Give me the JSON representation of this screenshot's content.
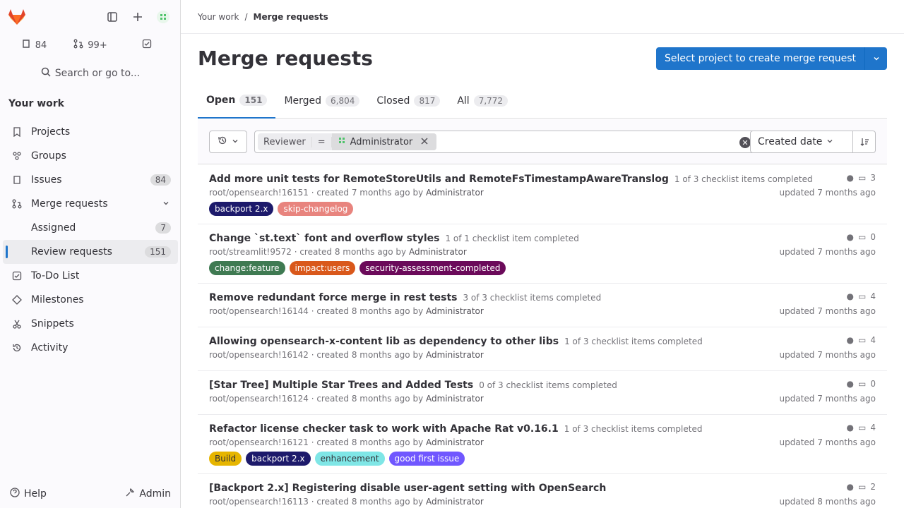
{
  "sidebar": {
    "counters": [
      {
        "icon": "issues-icon",
        "value": "84"
      },
      {
        "icon": "merge-request-icon",
        "value": "99+"
      },
      {
        "icon": "todo-icon",
        "value": ""
      }
    ],
    "search_label": "Search or go to...",
    "section_title": "Your work",
    "nav": {
      "projects": "Projects",
      "groups": "Groups",
      "issues": "Issues",
      "issues_count": "84",
      "merge_requests": "Merge requests",
      "assigned": "Assigned",
      "assigned_count": "7",
      "review_requests": "Review requests",
      "review_count": "151",
      "todo": "To-Do List",
      "milestones": "Milestones",
      "snippets": "Snippets",
      "activity": "Activity"
    },
    "help": "Help",
    "admin": "Admin"
  },
  "breadcrumb": {
    "parent": "Your work",
    "separator": "/",
    "current": "Merge requests"
  },
  "page": {
    "title": "Merge requests",
    "create_button": "Select project to create merge request"
  },
  "tabs": [
    {
      "label": "Open",
      "count": "151"
    },
    {
      "label": "Merged",
      "count": "6,804"
    },
    {
      "label": "Closed",
      "count": "817"
    },
    {
      "label": "All",
      "count": "7,772"
    }
  ],
  "filter": {
    "token_field": "Reviewer",
    "token_op": "=",
    "token_value": "Administrator",
    "sort_label": "Created date"
  },
  "merge_requests": [
    {
      "title": "Add more unit tests for RemoteStoreUtils and RemoteFsTimestampAwareTranslog",
      "checklist": "1 of 3 checklist items completed",
      "meta": "root/opensearch!16151 · created 7 months ago by",
      "author": "Administrator",
      "updated": "updated 7 months ago",
      "comments": "3",
      "labels": [
        {
          "text": "backport 2.x",
          "color": "#1d1a6b"
        },
        {
          "text": "skip-changelog",
          "color": "#e8847e"
        }
      ]
    },
    {
      "title": "Change `st.text` font and overflow styles",
      "checklist": "1 of 1 checklist item completed",
      "meta": "root/streamlit!9572 · created 8 months ago by",
      "author": "Administrator",
      "updated": "updated 7 months ago",
      "comments": "0",
      "labels": [
        {
          "text": "change:feature",
          "color": "#3f7a52"
        },
        {
          "text": "impact:users",
          "color": "#d9581b"
        },
        {
          "text": "security-assessment-completed",
          "color": "#6b0a5a"
        }
      ]
    },
    {
      "title": "Remove redundant force merge in rest tests",
      "checklist": "3 of 3 checklist items completed",
      "meta": "root/opensearch!16144 · created 8 months ago by",
      "author": "Administrator",
      "updated": "updated 7 months ago",
      "comments": "4",
      "labels": []
    },
    {
      "title": "Allowing opensearch-x-content lib as dependency to other libs",
      "checklist": "1 of 3 checklist items completed",
      "meta": "root/opensearch!16142 · created 8 months ago by",
      "author": "Administrator",
      "updated": "updated 7 months ago",
      "comments": "4",
      "labels": []
    },
    {
      "title": "[Star Tree] Multiple Star Trees and Added Tests",
      "checklist": "0 of 3 checklist items completed",
      "meta": "root/opensearch!16124 · created 8 months ago by",
      "author": "Administrator",
      "updated": "updated 7 months ago",
      "comments": "0",
      "labels": []
    },
    {
      "title": "Refactor license checker task to work with Apache Rat v0.16.1",
      "checklist": "1 of 3 checklist items completed",
      "meta": "root/opensearch!16121 · created 8 months ago by",
      "author": "Administrator",
      "updated": "updated 7 months ago",
      "comments": "4",
      "labels": [
        {
          "text": "Build",
          "color": "#e6b500"
        },
        {
          "text": "backport 2.x",
          "color": "#1d1a6b"
        },
        {
          "text": "enhancement",
          "color": "#7fe6e6"
        },
        {
          "text": "good first issue",
          "color": "#7057ff"
        }
      ]
    },
    {
      "title": "[Backport 2.x] Registering disable user-agent setting with OpenSearch",
      "checklist": "",
      "meta": "root/opensearch!16113 · created 8 months ago by",
      "author": "Administrator",
      "updated": "updated 8 months ago",
      "comments": "2",
      "labels": []
    }
  ]
}
